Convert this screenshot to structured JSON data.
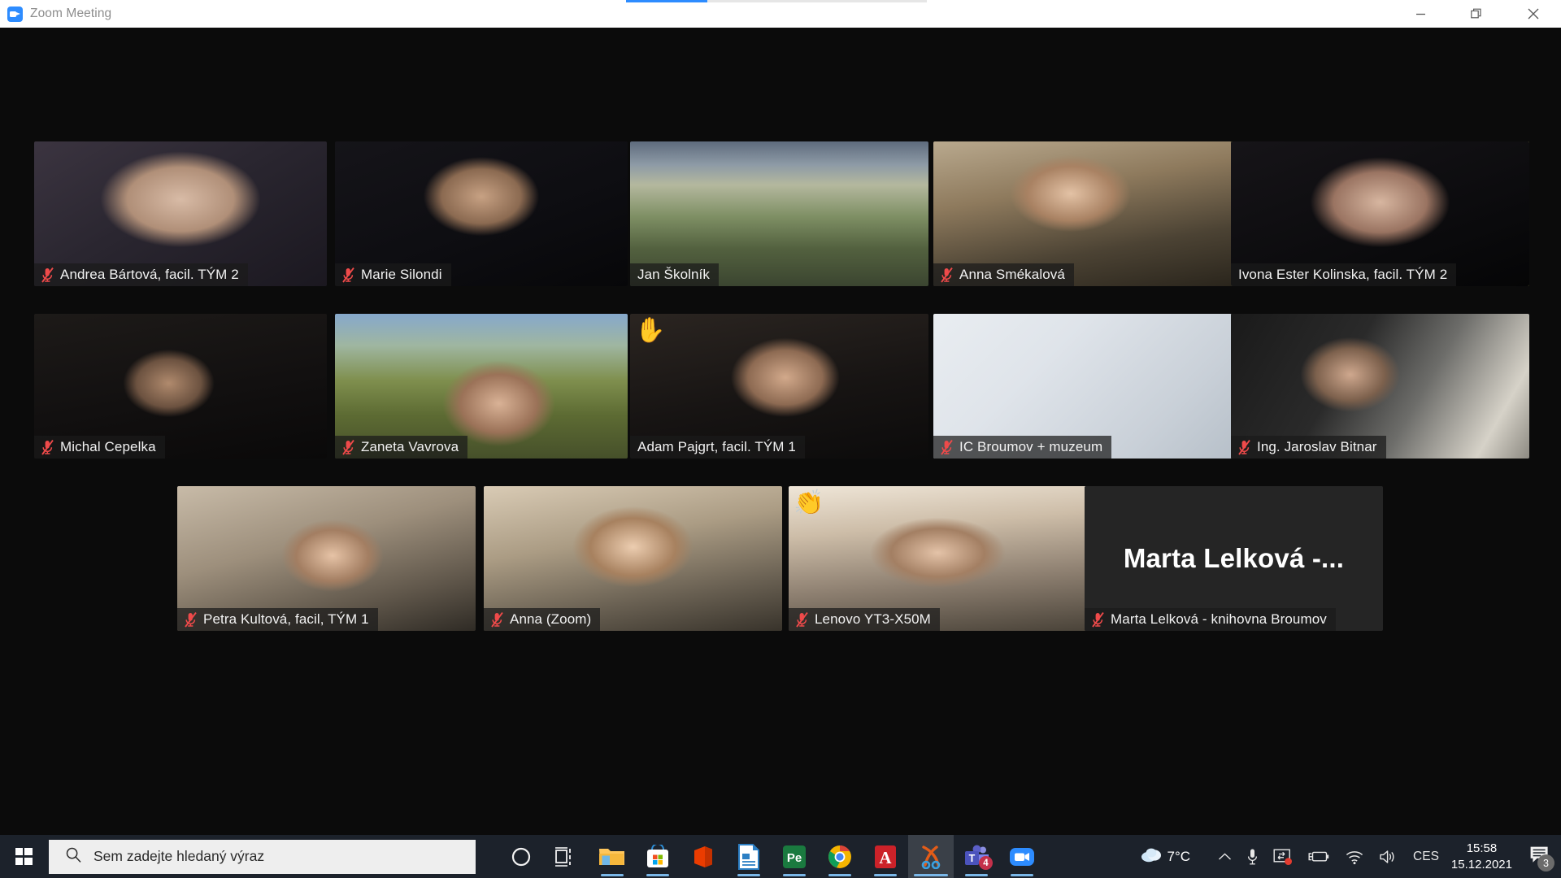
{
  "window": {
    "title": "Zoom Meeting",
    "app_icon": "zoom-video-icon",
    "minimize_label": "Minimize",
    "restore_label": "Restore",
    "close_label": "Close"
  },
  "meeting": {
    "participants": [
      {
        "name": "Andrea Bártová, facil. TÝM 2",
        "muted": true,
        "active_speaker": false,
        "kind": "video",
        "style": "v-andrea",
        "reaction": ""
      },
      {
        "name": "Marie Silondi",
        "muted": true,
        "active_speaker": false,
        "kind": "video",
        "style": "v-marie",
        "reaction": ""
      },
      {
        "name": "Jan Školník",
        "muted": false,
        "active_speaker": false,
        "kind": "video",
        "style": "v-jan",
        "reaction": ""
      },
      {
        "name": "Anna Smékalová",
        "muted": true,
        "active_speaker": false,
        "kind": "video",
        "style": "v-anna-s",
        "reaction": ""
      },
      {
        "name": "Ivona Ester Kolinska, facil. TÝM 2",
        "muted": false,
        "active_speaker": true,
        "kind": "video",
        "style": "v-ivona",
        "reaction": ""
      },
      {
        "name": "Michal Cepelka",
        "muted": true,
        "active_speaker": false,
        "kind": "video",
        "style": "v-michal",
        "reaction": ""
      },
      {
        "name": "Zaneta Vavrova",
        "muted": true,
        "active_speaker": false,
        "kind": "video",
        "style": "v-zaneta",
        "reaction": ""
      },
      {
        "name": "Adam Pajgrt, facil. TÝM 1",
        "muted": false,
        "active_speaker": false,
        "kind": "video",
        "style": "v-adam",
        "reaction": "✋"
      },
      {
        "name": "IC Broumov + muzeum",
        "muted": true,
        "active_speaker": false,
        "kind": "video",
        "style": "v-ic",
        "reaction": ""
      },
      {
        "name": "Ing. Jaroslav Bitnar",
        "muted": true,
        "active_speaker": false,
        "kind": "video",
        "style": "v-bitnar",
        "reaction": ""
      },
      {
        "name": "Petra Kultová, facil, TÝM 1",
        "muted": true,
        "active_speaker": false,
        "kind": "video",
        "style": "v-petra",
        "reaction": ""
      },
      {
        "name": "Anna (Zoom)",
        "muted": true,
        "active_speaker": false,
        "kind": "video",
        "style": "v-annaz",
        "reaction": ""
      },
      {
        "name": "Lenovo YT3-X50M",
        "muted": true,
        "active_speaker": false,
        "kind": "video",
        "style": "v-lenovo",
        "reaction": "👏"
      },
      {
        "name": "Marta Lelková - knihovna Broumov",
        "muted": true,
        "active_speaker": false,
        "kind": "avatar",
        "style": "v-marta",
        "avatar_text": "Marta Lelková -...",
        "reaction": ""
      }
    ],
    "active_speaker_border_color": "#e9ef70",
    "mute_icon_color": "#ef4a4a",
    "mute_icon_name": "mic-muted-icon"
  },
  "taskbar": {
    "start_label": "Start",
    "search": {
      "placeholder": "Sem zadejte hledaný výraz",
      "icon": "search-icon"
    },
    "apps": [
      {
        "name": "cortana-icon",
        "label": "Cortana",
        "running": false,
        "highlighted": false
      },
      {
        "name": "task-view-icon",
        "label": "Task View",
        "running": false,
        "highlighted": false
      },
      {
        "name": "file-explorer-icon",
        "label": "File Explorer",
        "running": true,
        "highlighted": false
      },
      {
        "name": "microsoft-store-icon",
        "label": "Microsoft Store",
        "running": true,
        "highlighted": false
      },
      {
        "name": "microsoft-office-icon",
        "label": "Office",
        "running": false,
        "highlighted": false
      },
      {
        "name": "libreoffice-writer-icon",
        "label": "LibreOffice Writer",
        "running": true,
        "highlighted": false
      },
      {
        "name": "photoshop-elements-icon",
        "label": "Photoshop Elements",
        "running": true,
        "highlighted": false
      },
      {
        "name": "google-chrome-icon",
        "label": "Google Chrome",
        "running": true,
        "highlighted": false
      },
      {
        "name": "adobe-acrobat-icon",
        "label": "Adobe Acrobat Reader",
        "running": true,
        "highlighted": false
      },
      {
        "name": "snipping-tool-icon",
        "label": "Snipping Tool",
        "running": true,
        "highlighted": true
      },
      {
        "name": "microsoft-teams-icon",
        "label": "Microsoft Teams",
        "running": true,
        "highlighted": false,
        "badge": "4"
      },
      {
        "name": "zoom-icon",
        "label": "Zoom",
        "running": true,
        "highlighted": false
      }
    ],
    "tray": {
      "weather_icon": "cloud-icon",
      "weather_temp": "7°C",
      "show_hidden_icon": "chevron-up-icon",
      "microphone_icon": "microphone-icon",
      "screen_recording_icon": "screen-share-recording-icon",
      "battery_icon": "battery-charging-icon",
      "network_icon": "wifi-icon",
      "volume_icon": "speaker-icon",
      "language": "CES",
      "clock_time": "15:58",
      "clock_date": "15.12.2021",
      "notifications_icon": "action-center-icon",
      "notifications_count": "3"
    }
  }
}
